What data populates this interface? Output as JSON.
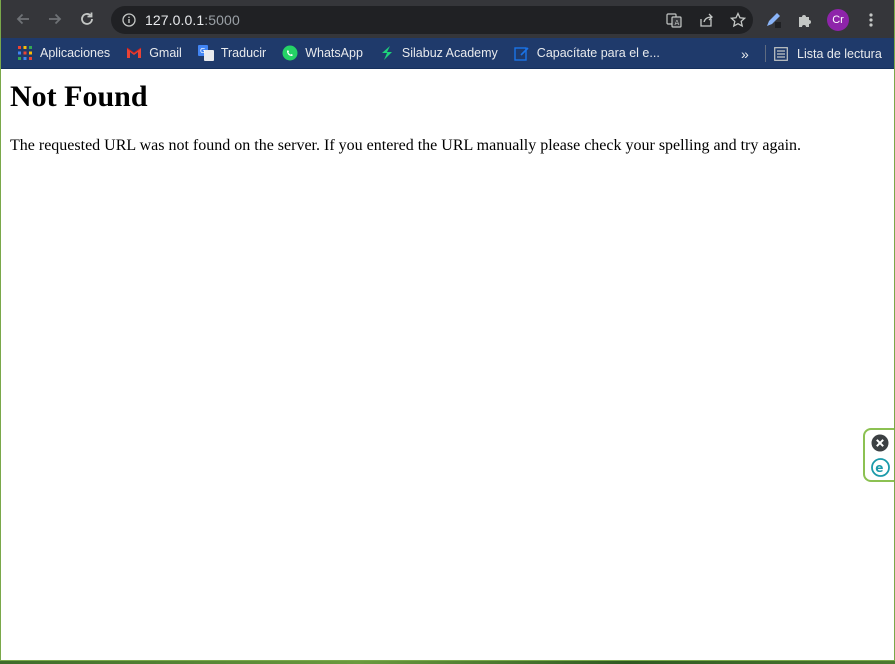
{
  "toolbar": {
    "url_host": "127.0.0.1",
    "url_port": ":5000",
    "icons": {
      "back": "arrow-left-icon",
      "forward": "arrow-right-icon",
      "reload": "reload-icon",
      "info": "info-icon",
      "translate": "translate-icon",
      "share": "share-icon",
      "bookmark": "star-icon",
      "edit": "pen-icon",
      "extensions": "puzzle-icon",
      "menu": "kebab-menu-icon"
    },
    "avatar_initials": "Cr"
  },
  "bookmarks": {
    "items": [
      {
        "label": "Aplicaciones",
        "icon": "apps-grid-icon"
      },
      {
        "label": "Gmail",
        "icon": "gmail-icon"
      },
      {
        "label": "Traducir",
        "icon": "translate-icon"
      },
      {
        "label": "WhatsApp",
        "icon": "whatsapp-icon"
      },
      {
        "label": "Silabuz Academy",
        "icon": "silabuz-icon"
      },
      {
        "label": "Capacítate para el e...",
        "icon": "edit-doc-icon"
      }
    ],
    "more": "»",
    "reading_list": "Lista de lectura"
  },
  "page": {
    "title": "Not Found",
    "message": "The requested URL was not found on the server. If you entered the URL manually please check your spelling and try again."
  },
  "colors": {
    "toolbar_bg": "#35363a",
    "omnibox_bg": "#202124",
    "bookmarks_bg": "#1f3a6b",
    "avatar_bg": "#8e24aa",
    "widget_border": "#8cc152"
  }
}
